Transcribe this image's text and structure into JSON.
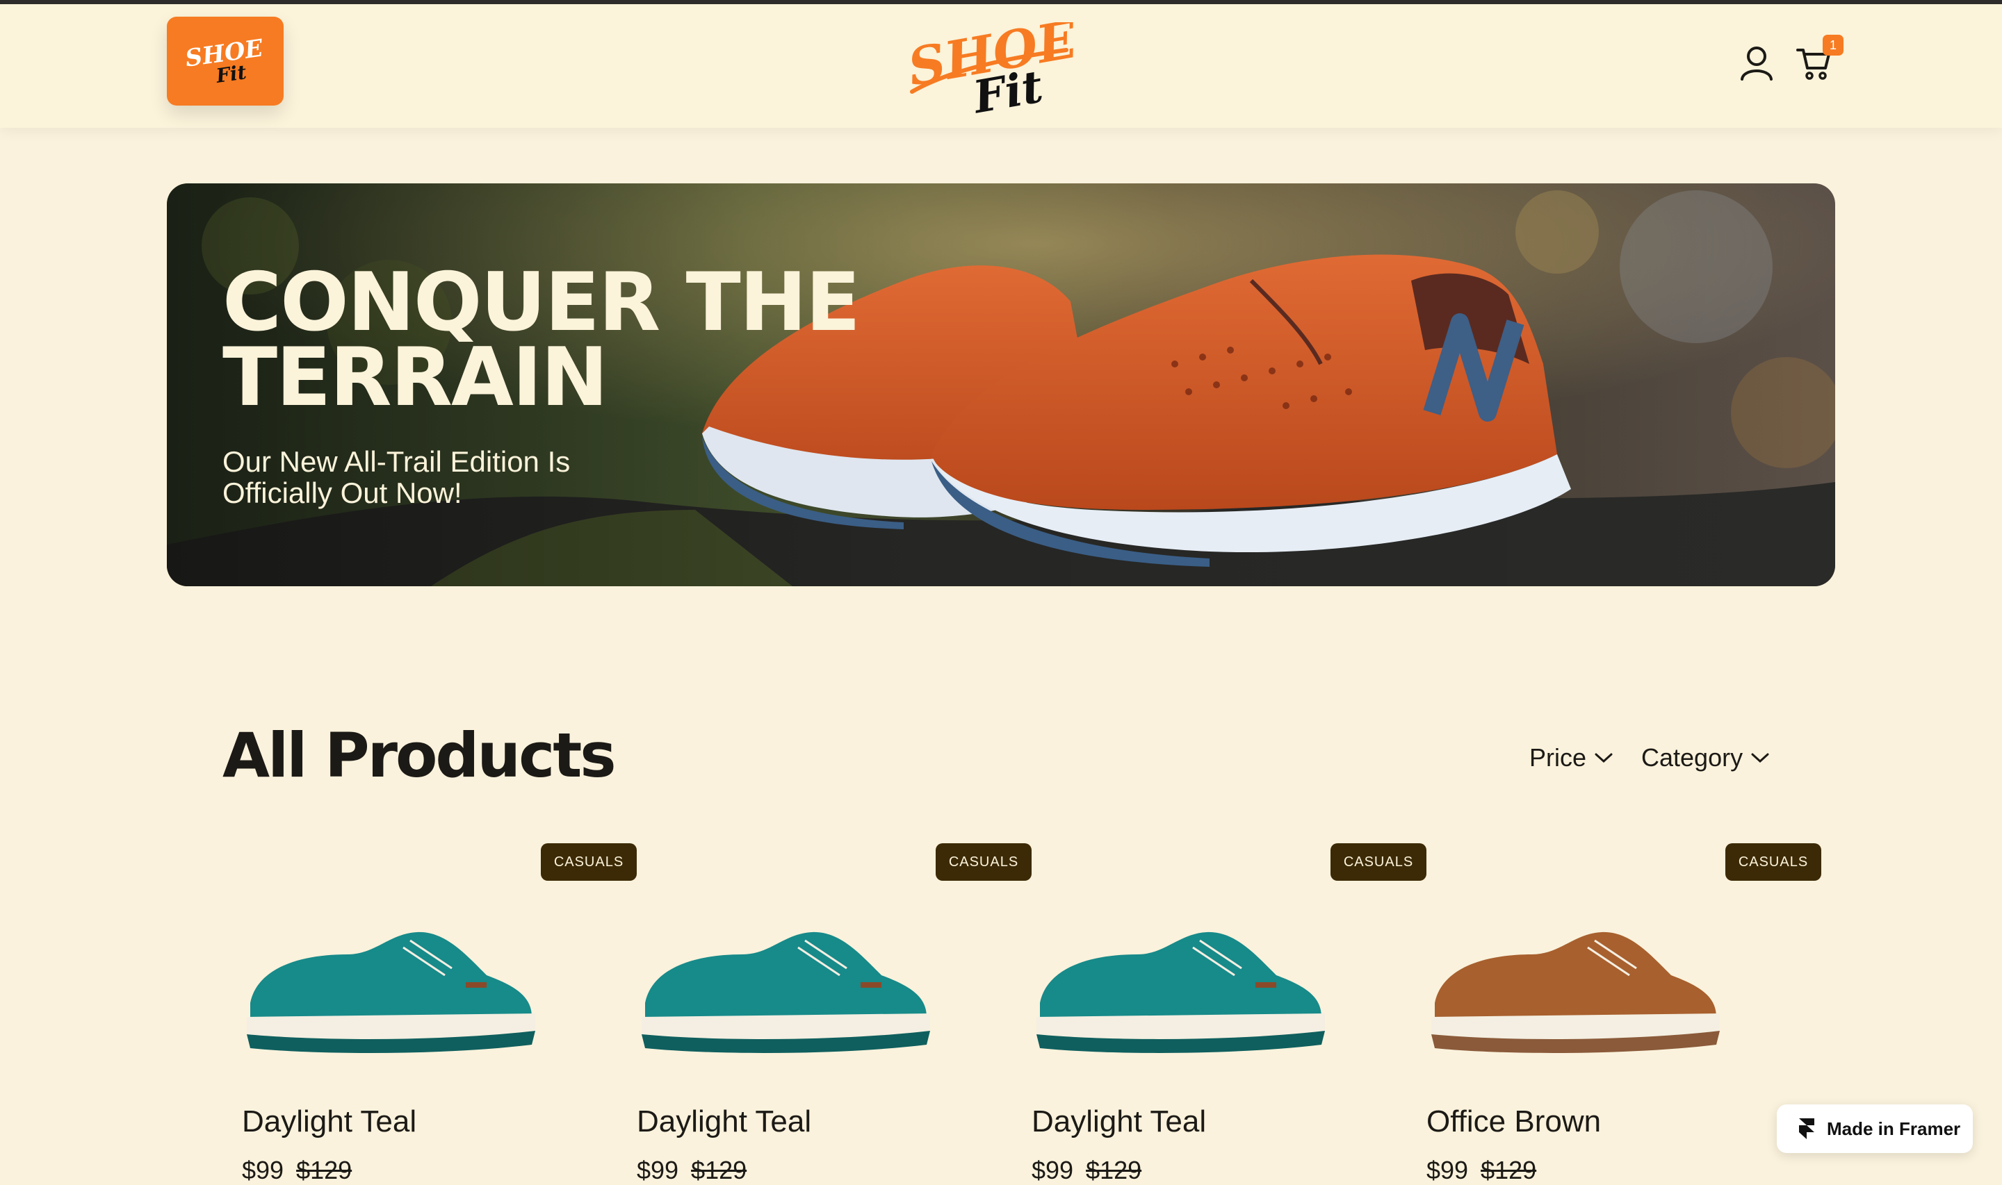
{
  "header": {
    "logo_small_text": "SHOE Fit",
    "logo_main_word1": "SHOE",
    "logo_main_word2": "Fit",
    "cart_count": "1",
    "icons": [
      "user-icon",
      "cart-icon"
    ],
    "accent_color": "#F77B22"
  },
  "hero": {
    "title": "Conquer the Terrain",
    "subtitle": "Our New All-Trail Edition Is Officially Out Now!"
  },
  "products_section": {
    "title": "All Products",
    "filters": [
      {
        "label": "Price"
      },
      {
        "label": "Category"
      }
    ]
  },
  "products": [
    {
      "badge": "CASUALS",
      "name": "Daylight Teal",
      "price": "$99",
      "old_price": "$129",
      "color": "#178A8A"
    },
    {
      "badge": "CASUALS",
      "name": "Daylight Teal",
      "price": "$99",
      "old_price": "$129",
      "color": "#178A8A"
    },
    {
      "badge": "CASUALS",
      "name": "Daylight Teal",
      "price": "$99",
      "old_price": "$129",
      "color": "#178A8A"
    },
    {
      "badge": "CASUALS",
      "name": "Office Brown",
      "price": "$99",
      "old_price": "$129",
      "color": "#A8602E"
    }
  ],
  "framer_badge": {
    "label": "Made in Framer"
  }
}
